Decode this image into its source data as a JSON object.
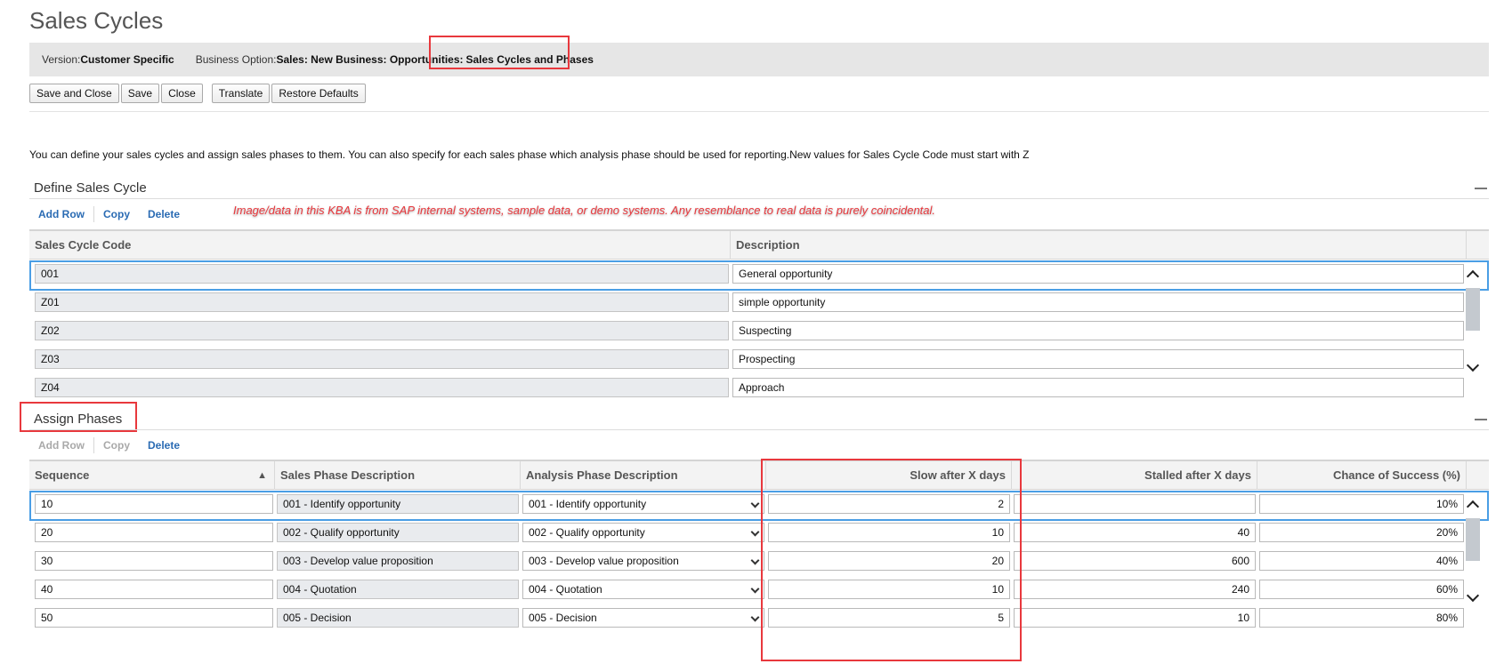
{
  "page": {
    "title": "Sales Cycles"
  },
  "info": {
    "version_label": "Version:",
    "version_value": "Customer Specific",
    "option_label": "Business Option:",
    "option_value_prefix": "Sales: New Business: Opportunities: ",
    "option_value_highlight": "Sales Cycles and Phases"
  },
  "toolbar": {
    "save_close": "Save and Close",
    "save": "Save",
    "close": "Close",
    "translate": "Translate",
    "restore": "Restore Defaults"
  },
  "description": "You can define your sales cycles and assign sales phases to them. You can also specify for each sales phase which analysis phase should be used for reporting.New values for Sales Cycle Code must start with Z",
  "watermark": "Image/data in this KBA is from SAP internal systems, sample data, or demo systems. Any resemblance to real data is purely coincidental.",
  "define": {
    "title": "Define Sales Cycle",
    "actions": {
      "add": "Add Row",
      "copy": "Copy",
      "delete": "Delete"
    },
    "columns": {
      "code": "Sales Cycle Code",
      "desc": "Description"
    },
    "rows": [
      {
        "code": "001",
        "desc": "General opportunity"
      },
      {
        "code": "Z01",
        "desc": "simple opportunity"
      },
      {
        "code": "Z02",
        "desc": "Suspecting"
      },
      {
        "code": "Z03",
        "desc": "Prospecting"
      },
      {
        "code": "Z04",
        "desc": "Approach"
      }
    ]
  },
  "assign": {
    "title": "Assign Phases",
    "actions": {
      "add": "Add Row",
      "copy": "Copy",
      "delete": "Delete"
    },
    "columns": {
      "seq": "Sequence",
      "sales": "Sales Phase Description",
      "analysis": "Analysis Phase Description",
      "slow": "Slow after X days",
      "stalled": "Stalled after X days",
      "chance": "Chance of Success (%)"
    },
    "rows": [
      {
        "seq": "10",
        "sales": "001 - Identify opportunity",
        "analysis": "001 - Identify opportunity",
        "slow": "2",
        "stalled": "",
        "chance": "10%"
      },
      {
        "seq": "20",
        "sales": "002 - Qualify opportunity",
        "analysis": "002 - Qualify opportunity",
        "slow": "10",
        "stalled": "40",
        "chance": "20%"
      },
      {
        "seq": "30",
        "sales": "003 - Develop value proposition",
        "analysis": "003 - Develop value proposition",
        "slow": "20",
        "stalled": "600",
        "chance": "40%"
      },
      {
        "seq": "40",
        "sales": "004 - Quotation",
        "analysis": "004 - Quotation",
        "slow": "10",
        "stalled": "240",
        "chance": "60%"
      },
      {
        "seq": "50",
        "sales": "005 - Decision",
        "analysis": "005 - Decision",
        "slow": "5",
        "stalled": "10",
        "chance": "80%"
      }
    ]
  },
  "colors": {
    "highlight": "#e8383d",
    "link": "#2a6bb3",
    "selection": "#4a9ee5"
  }
}
